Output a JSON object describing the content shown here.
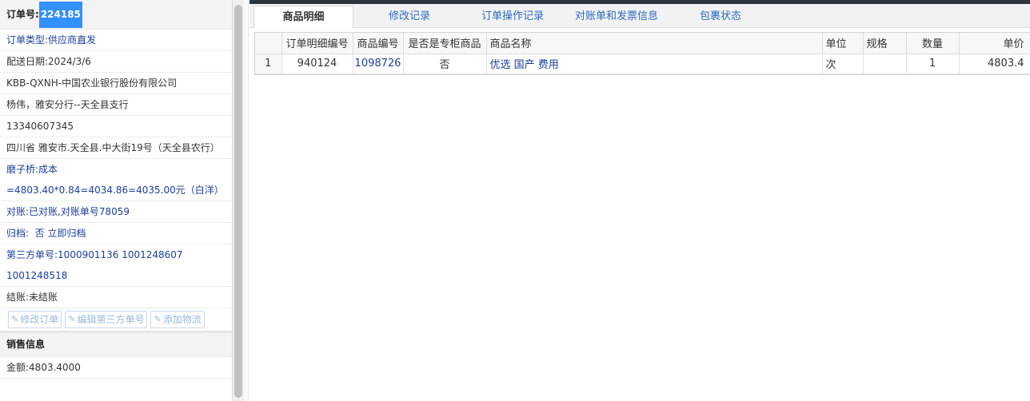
{
  "order": {
    "number_label": "订单号:",
    "number": "224185",
    "type": "订单类型:供应商直发",
    "delivery_date": "配送日期:2024/3/6",
    "customer": "KBB-QXNH-中国农业银行股份有限公司",
    "contact": "杨伟，雅安分行--天全县支行",
    "phone": "13340607345",
    "address": "四川省 雅安市.天全县.中大街19号（天全县农行）",
    "cost": "磨子桥:成本=4803.40*0.84=4034.86=4035.00元（白洋）",
    "reconcile": "对账:已对账,对账单号78059",
    "archive": "归档:  否 立即归档",
    "third_party": "第三方单号:1000901136 1001248607 1001248518",
    "settle": "结账:未结账"
  },
  "buttons": {
    "edit_order": "修改订单",
    "edit_third": "编辑第三方单号",
    "add_logistics": "添加物流"
  },
  "sales": {
    "header": "销售信息",
    "amount": "金额:4803.4000"
  },
  "tabs": [
    "商品明细",
    "修改记录",
    "订单操作记录",
    "对账单和发票信息",
    "包裹状态"
  ],
  "table": {
    "columns": [
      "",
      "订单明细编号",
      "商品编号",
      "是否是专柜商品",
      "商品名称",
      "单位",
      "规格",
      "数量",
      "单价"
    ],
    "rows": [
      [
        "1",
        "940124",
        "1098726",
        "否",
        "优选 国产 费用",
        "次",
        "",
        "1",
        "4803.4"
      ]
    ]
  }
}
